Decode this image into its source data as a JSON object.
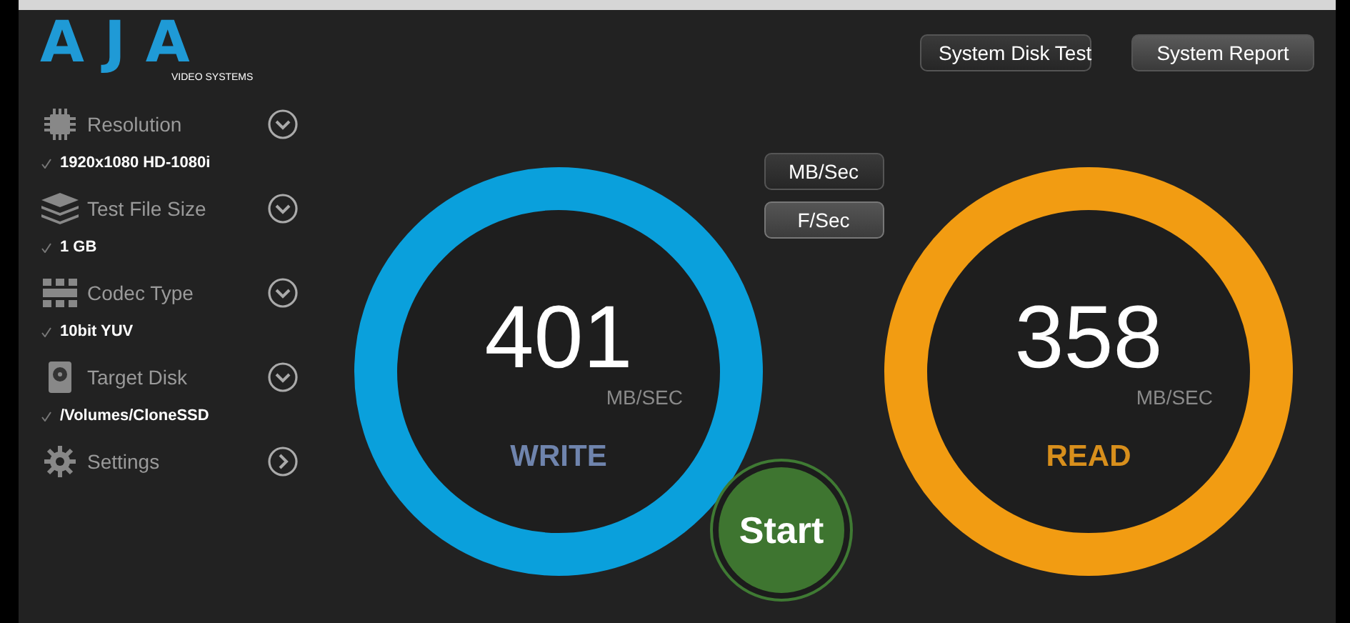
{
  "logo": {
    "name": "AJA",
    "tagline": "VIDEO SYSTEMS"
  },
  "sidebar": {
    "items": [
      {
        "kind": "chip",
        "label": "Resolution",
        "expands": true,
        "value": "1920x1080 HD-1080i",
        "checked": true
      },
      {
        "kind": "stack",
        "label": "Test File Size",
        "expands": true,
        "value": "1 GB",
        "checked": true
      },
      {
        "kind": "grid",
        "label": "Codec Type",
        "expands": true,
        "value": "10bit YUV",
        "checked": true
      },
      {
        "kind": "disk",
        "label": "Target Disk",
        "expands": true,
        "value": "/Volumes/CloneSSD",
        "checked": true
      },
      {
        "kind": "gear",
        "label": "Settings",
        "expands": false
      }
    ]
  },
  "toolbar": {
    "buttons": [
      "System Disk Test",
      "System Report"
    ]
  },
  "units": [
    {
      "label": "MB/Sec",
      "selected": false
    },
    {
      "label": "F/Sec",
      "selected": true
    }
  ],
  "gauges": [
    {
      "value": "401",
      "unit": "MB/SEC",
      "label": "WRITE",
      "color": "#0aa0dc"
    },
    {
      "value": "358",
      "unit": "MB/SEC",
      "label": "READ",
      "color": "#f29c12"
    }
  ],
  "start_button": {
    "label": "Start"
  }
}
